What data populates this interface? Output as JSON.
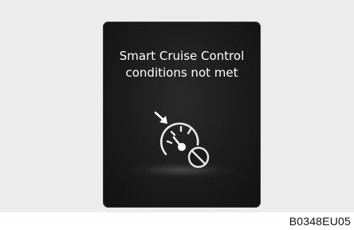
{
  "display": {
    "message_line1": "Smart Cruise Control",
    "message_line2": "conditions not met"
  },
  "icons": {
    "status": "smart-cruise-control-not-available-icon",
    "gauge": "speedometer-gauge-icon",
    "arrow": "set-arrow-icon",
    "prohibited": "prohibited-circle-icon"
  },
  "figure": {
    "code": "B0348EU05"
  },
  "colors": {
    "display_background": "#1b1b1b",
    "text": "#ffffff",
    "icon_stroke": "#e8e8e8",
    "frame_background": "#ececec"
  }
}
